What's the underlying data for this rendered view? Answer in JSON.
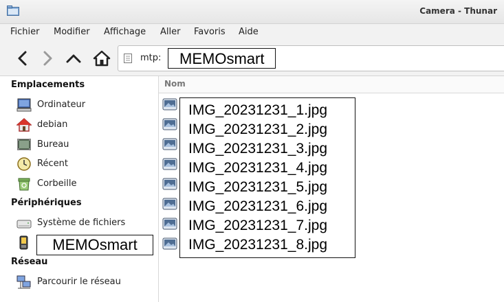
{
  "window": {
    "title": "Camera - Thunar"
  },
  "menu": [
    "Fichier",
    "Modifier",
    "Affichage",
    "Aller",
    "Favoris",
    "Aide"
  ],
  "location": {
    "scheme": "mtp:",
    "value": "MEMOsmart"
  },
  "sidebar": {
    "places_header": "Emplacements",
    "places": [
      {
        "label": "Ordinateur",
        "icon": "computer-icon"
      },
      {
        "label": "debian",
        "icon": "home-icon"
      },
      {
        "label": "Bureau",
        "icon": "desktop-icon"
      },
      {
        "label": "Récent",
        "icon": "recent-icon"
      },
      {
        "label": "Corbeille",
        "icon": "trash-icon"
      }
    ],
    "devices_header": "Périphériques",
    "devices": [
      {
        "label": "Système de fichiers",
        "icon": "drive-icon"
      },
      {
        "label": "MEMOsmart",
        "icon": "phone-icon"
      }
    ],
    "network_header": "Réseau",
    "network": [
      {
        "label": "Parcourir le réseau",
        "icon": "network-icon"
      }
    ]
  },
  "list": {
    "column_name": "Nom",
    "files": [
      "IMG_20231231_1.jpg",
      "IMG_20231231_2.jpg",
      "IMG_20231231_3.jpg",
      "IMG_20231231_4.jpg",
      "IMG_20231231_5.jpg",
      "IMG_20231231_6.jpg",
      "IMG_20231231_7.jpg",
      "IMG_20231231_8.jpg"
    ]
  }
}
